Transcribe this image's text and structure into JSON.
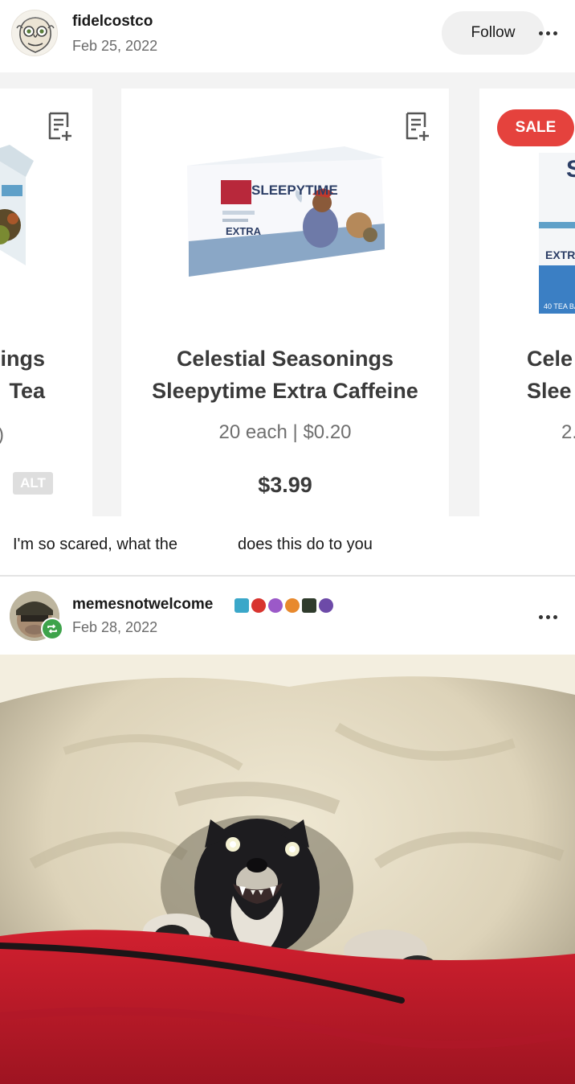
{
  "post1": {
    "username": "fidelcostco",
    "date": "Feb 25, 2022",
    "follow_label": "Follow"
  },
  "carousel": {
    "left_card": {
      "name_line1": "ings",
      "name_line2": "Tea",
      "qty_fragment": ")",
      "alt_label": "ALT"
    },
    "center_card": {
      "box_brand": "SLEEPYTIME",
      "box_variant": "EXTRA",
      "name_line1": "Celestial Seasonings",
      "name_line2": "Sleepytime Extra Caffeine",
      "quantity": "20 each",
      "unit_price": "| $0.20",
      "price": "$3.99"
    },
    "right_card": {
      "sale_label": "SALE",
      "name_line1": "Cele",
      "name_line2": "Slee",
      "qty_fragment": "2.",
      "box_variant": "EXTR",
      "box_count": "40 TEA BA"
    }
  },
  "caption": {
    "part1": "I'm so scared, what the",
    "part2": "does this do to you"
  },
  "post2": {
    "username": "memesnotwelcome",
    "date": "Feb 28, 2022",
    "badge_colors": [
      "#3aa7c9",
      "#d8342f",
      "#9b59c8",
      "#e8892d",
      "#2f3b2c",
      "#6d4aa8"
    ]
  },
  "icons": {
    "more": "more-options-icon",
    "list_add": "add-to-list-icon",
    "reblog": "reblog-icon"
  },
  "colors": {
    "sale_red": "#e5423d",
    "follow_bg": "#f0f0f0",
    "reblog_green": "#3ea34b",
    "blanket_red": "#c01a28"
  }
}
